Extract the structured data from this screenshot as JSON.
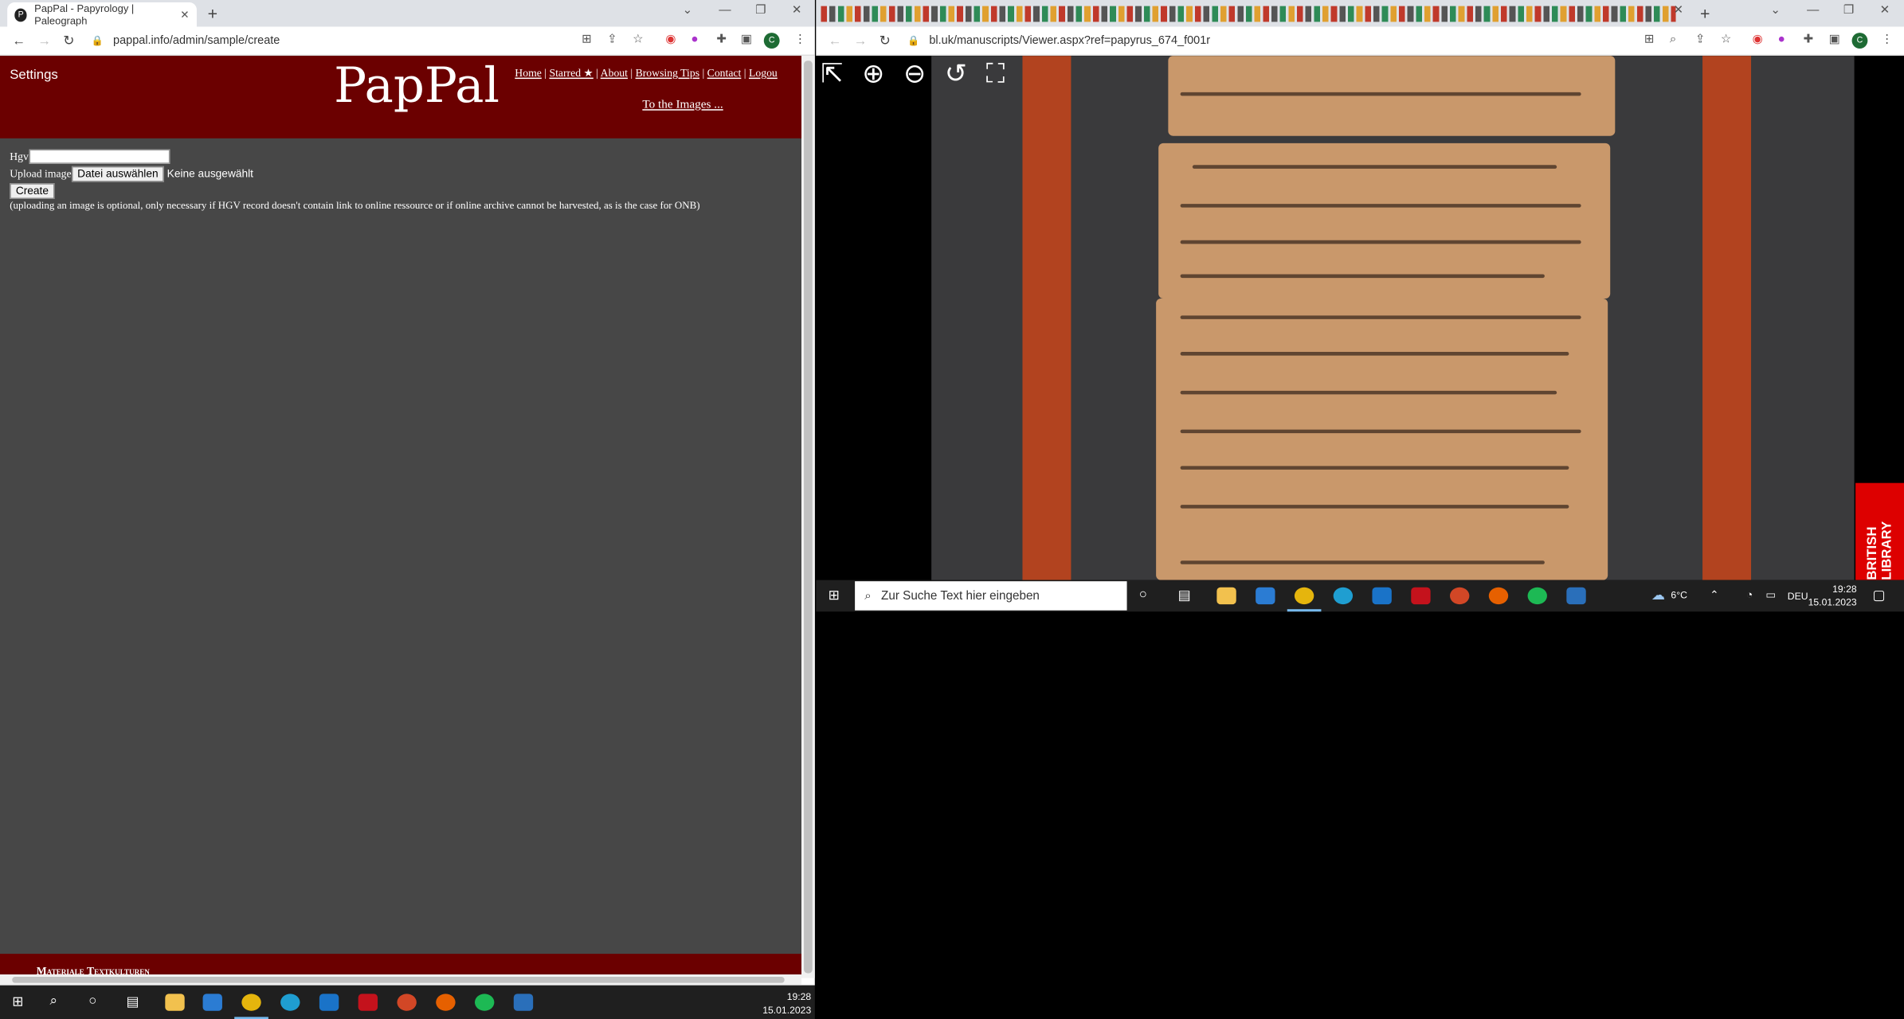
{
  "left_browser": {
    "tab_title": "PapPal - Papyrology | Paleograph",
    "url": "pappal.info/admin/sample/create"
  },
  "pappal": {
    "settings": "Settings",
    "logo": "PapPal",
    "nav": [
      "Home",
      "Starred ★",
      "About",
      "Browsing Tips",
      "Contact",
      "Logou"
    ],
    "to_images": "To the Images ...",
    "hgv_label": "Hgv",
    "upload_label": "Upload image",
    "file_button": "Datei auswählen",
    "file_status": "Keine ausgewählt",
    "create_button": "Create",
    "note": "(uploading an image is optional, only necessary if HGV record doesn't contain link to online ressource or if online archive cannot be harvested, as is the case for ONB)",
    "footer": "Materiale Textkulturen"
  },
  "right_browser": {
    "url": "bl.uk/manuscripts/Viewer.aspx?ref=papyrus_674_f001r"
  },
  "viewer": {
    "badge": "BRITISH LIBRARY"
  },
  "taskbar_right": {
    "search_placeholder": "Zur Suche Text hier eingeben",
    "weather": "6°C",
    "lang": "DEU",
    "time": "19:28",
    "date": "15.01.2023"
  },
  "taskbar_left": {
    "time": "19:28",
    "date": "15.01.2023"
  },
  "icons": [
    "windows-icon",
    "search-icon",
    "cortana-icon",
    "task-view-icon",
    "explorer-icon",
    "store-icon",
    "chrome-icon",
    "edge-icon",
    "mail-icon",
    "acrobat-icon",
    "powerpoint-icon",
    "firefox-icon",
    "spotify-icon",
    "photos-icon"
  ]
}
